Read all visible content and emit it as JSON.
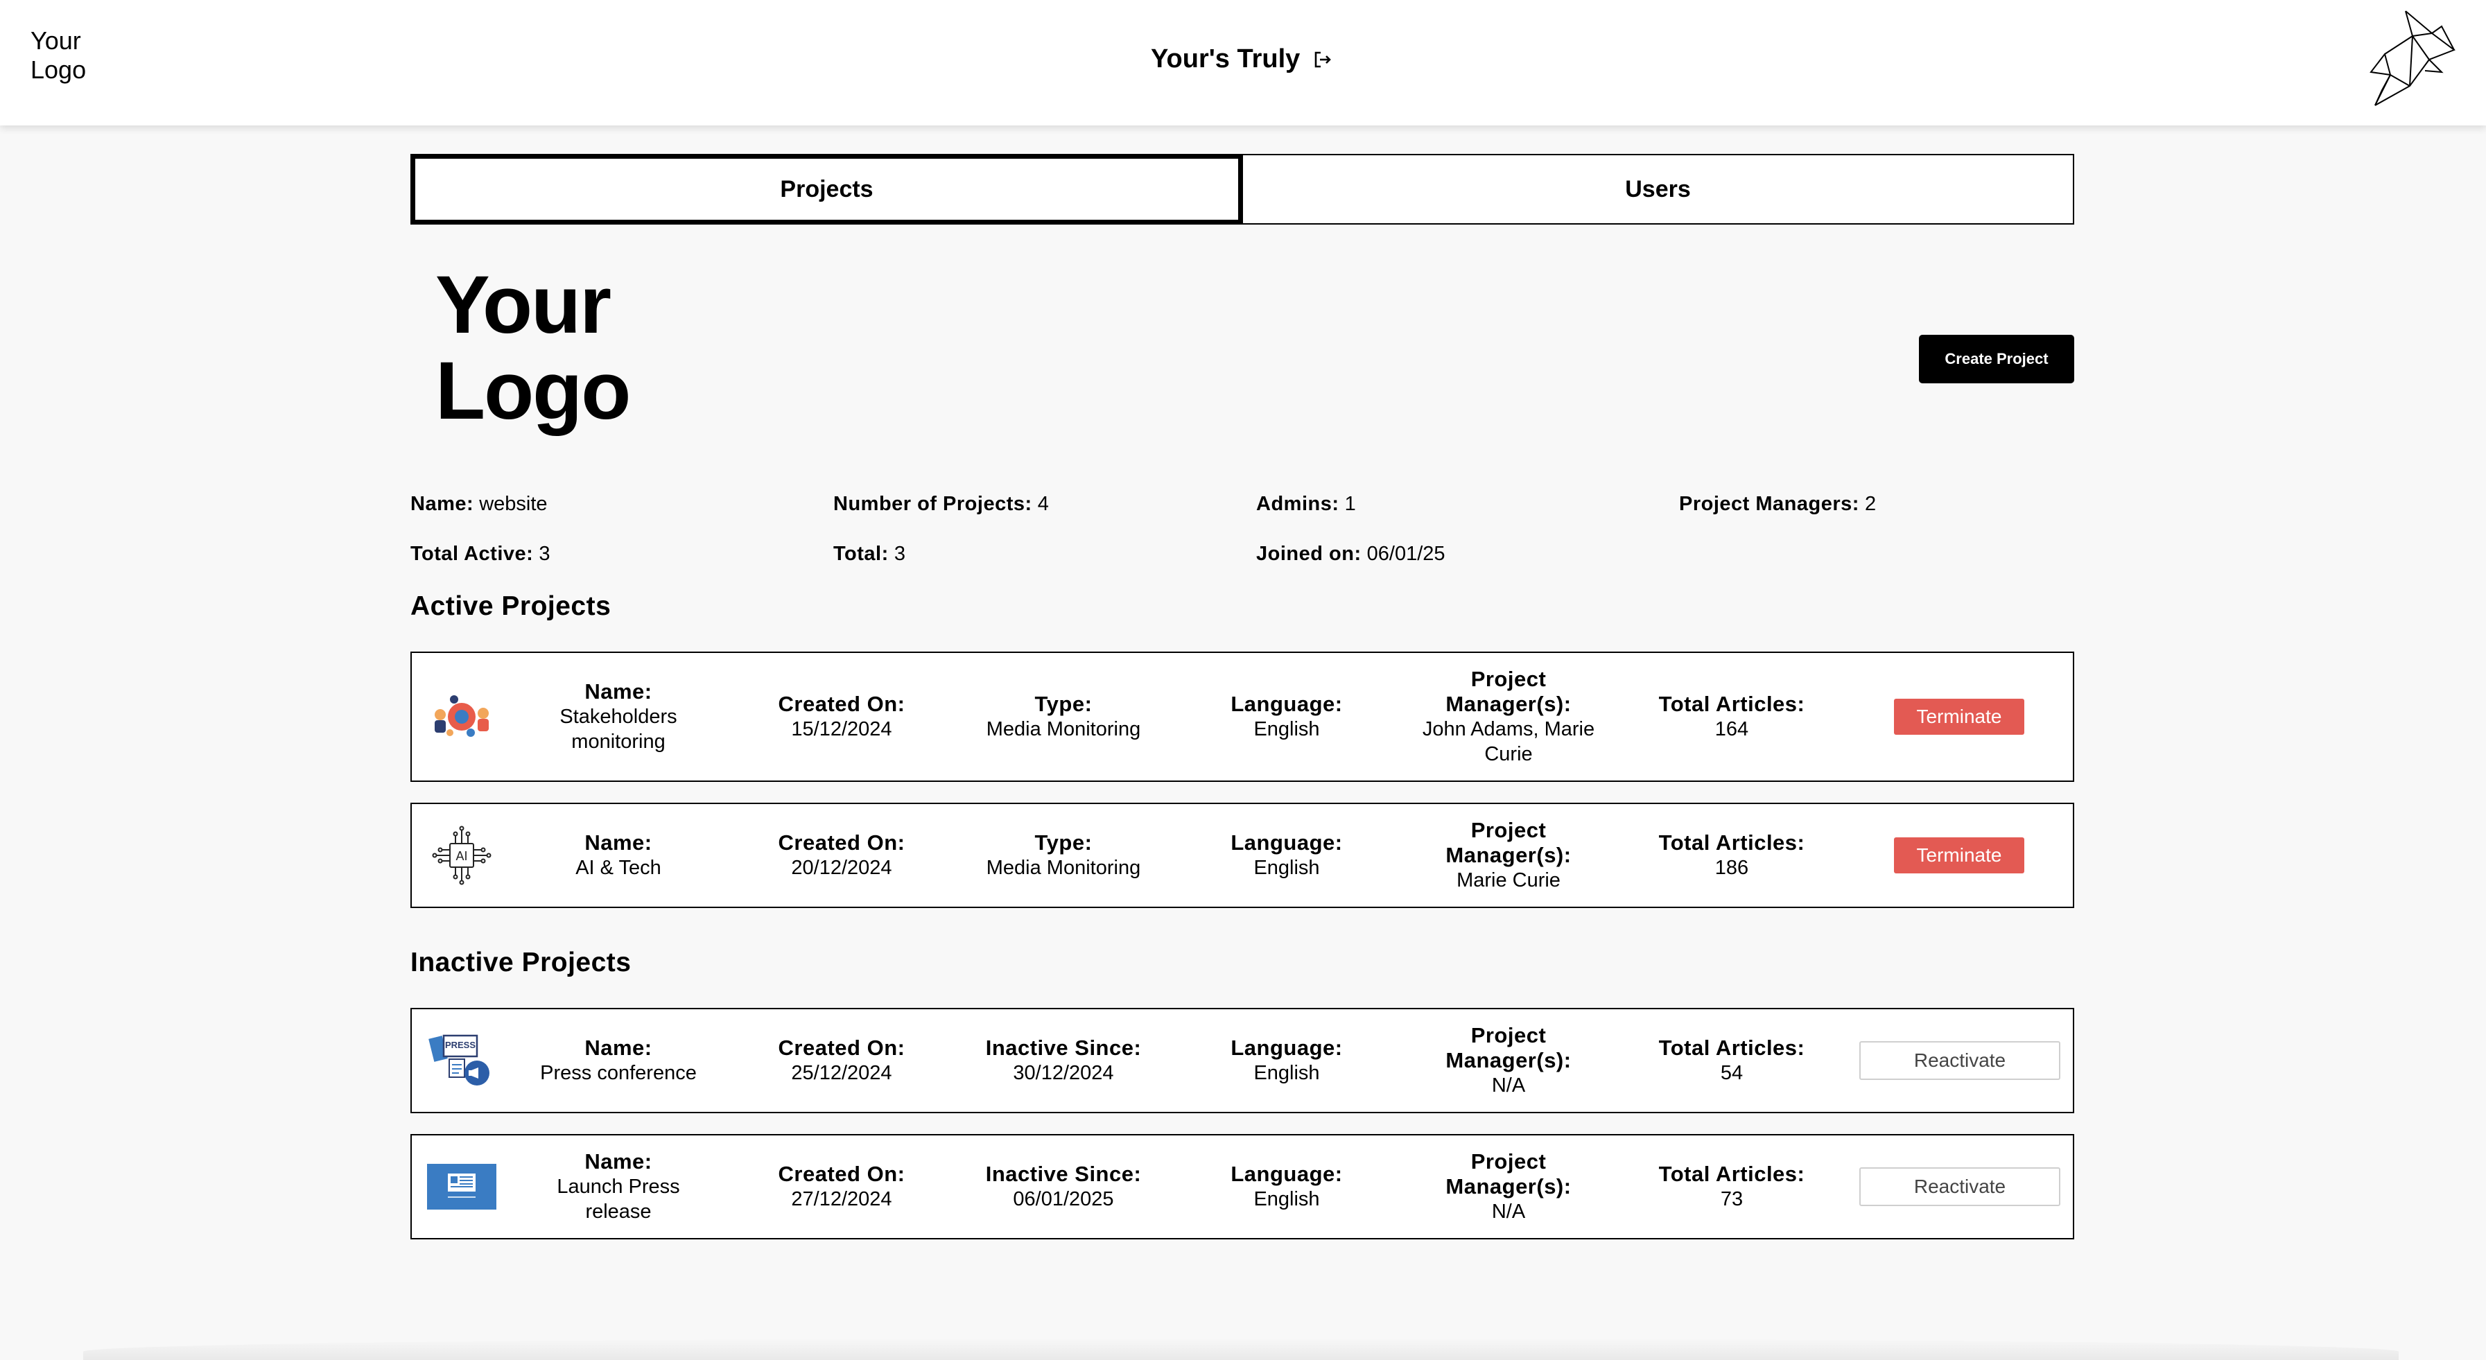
{
  "header": {
    "logo_line1": "Your",
    "logo_line2": "Logo",
    "user_name": "Your's Truly",
    "logout_icon": "logout-icon",
    "brand_icon": "origami-bird-icon"
  },
  "tabs": [
    {
      "label": "Projects",
      "active": true
    },
    {
      "label": "Users",
      "active": false
    }
  ],
  "org": {
    "logo_line1": "Your",
    "logo_line2": "Logo",
    "create_button": "Create Project",
    "stats": {
      "name_label": "Name:",
      "name_value": "website",
      "num_projects_label": "Number of Projects:",
      "num_projects_value": "4",
      "admins_label": "Admins:",
      "admins_value": "1",
      "pms_label": "Project Managers:",
      "pms_value": "2",
      "total_active_label": "Total Active:",
      "total_active_value": "3",
      "total_label": "Total:",
      "total_value": "3",
      "joined_label": "Joined on:",
      "joined_value": "06/01/25"
    }
  },
  "active_section": {
    "title": "Active Projects",
    "projects": [
      {
        "icon": "team-collaboration-icon",
        "name_label": "Name:",
        "name": "Stakeholders monitoring",
        "created_label": "Created On:",
        "created": "15/12/2024",
        "type_label": "Type:",
        "type": "Media Monitoring",
        "language_label": "Language:",
        "language": "English",
        "pm_label": "Project Manager(s):",
        "pm": "John Adams, Marie Curie",
        "articles_label": "Total Articles:",
        "articles": "164",
        "action": "Terminate"
      },
      {
        "icon": "ai-chip-icon",
        "name_label": "Name:",
        "name": "AI & Tech",
        "created_label": "Created On:",
        "created": "20/12/2024",
        "type_label": "Type:",
        "type": "Media Monitoring",
        "language_label": "Language:",
        "language": "English",
        "pm_label": "Project Manager(s):",
        "pm": "Marie Curie",
        "articles_label": "Total Articles:",
        "articles": "186",
        "action": "Terminate"
      }
    ]
  },
  "inactive_section": {
    "title": "Inactive Projects",
    "projects": [
      {
        "icon": "press-conference-icon",
        "name_label": "Name:",
        "name": "Press conference",
        "created_label": "Created On:",
        "created": "25/12/2024",
        "since_label": "Inactive Since:",
        "since": "30/12/2024",
        "language_label": "Language:",
        "language": "English",
        "pm_label": "Project Manager(s):",
        "pm": "N/A",
        "articles_label": "Total Articles:",
        "articles": "54",
        "action": "Reactivate"
      },
      {
        "icon": "press-release-icon",
        "name_label": "Name:",
        "name": "Launch Press release",
        "created_label": "Created On:",
        "created": "27/12/2024",
        "since_label": "Inactive Since:",
        "since": "06/01/2025",
        "language_label": "Language:",
        "language": "English",
        "pm_label": "Project Manager(s):",
        "pm": "N/A",
        "articles_label": "Total Articles:",
        "articles": "73",
        "action": "Reactivate"
      }
    ]
  },
  "colors": {
    "terminate": "#e35a53",
    "background": "#f8f8f8",
    "press_blue": "#3a7cc3"
  }
}
